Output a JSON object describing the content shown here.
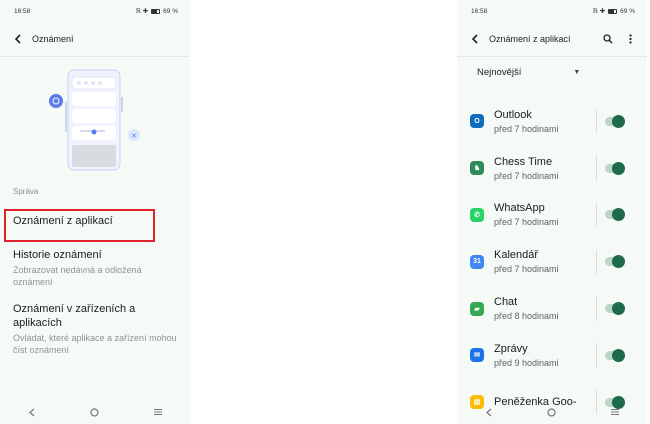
{
  "left": {
    "status": {
      "time": "16:58",
      "icons": "ℝ ✚",
      "battery": "69 %"
    },
    "appbar": {
      "title": "Oznámení"
    },
    "section_header": "Správa",
    "items": [
      {
        "title": "Oznámení z aplikací",
        "subtitle": ""
      },
      {
        "title": "Historie oznámení",
        "subtitle": "Zobrazovat nedávná a odložená oznámení"
      },
      {
        "title": "Oznámení v zařízeních a aplikacích",
        "subtitle": "Ovládat, které aplikace a zařízení mohou číst oznámení"
      }
    ],
    "highlight_color": "#e0242b"
  },
  "right": {
    "status": {
      "time": "16:58",
      "icons": "ℝ ✚",
      "battery": "69 %"
    },
    "appbar": {
      "title": "Oznámení z aplikací"
    },
    "sort": {
      "selected": "Nejnovější"
    },
    "apps": [
      {
        "name": "Outlook",
        "time": "před 7 hodinami",
        "enabled": true,
        "icon": "outlook-icon",
        "color": "#0f6cbd",
        "glyph": "O"
      },
      {
        "name": "Chess Time",
        "time": "před 7 hodinami",
        "enabled": true,
        "icon": "chess-time-icon",
        "color": "#2e8b57",
        "glyph": "♞"
      },
      {
        "name": "WhatsApp",
        "time": "před 7 hodinami",
        "enabled": true,
        "icon": "whatsapp-icon",
        "color": "#25d366",
        "glyph": "✆"
      },
      {
        "name": "Kalendář",
        "time": "před 7 hodinami",
        "enabled": true,
        "icon": "calendar-icon",
        "color": "#4285f4",
        "glyph": "31"
      },
      {
        "name": "Chat",
        "time": "před 8 hodinami",
        "enabled": true,
        "icon": "chat-icon",
        "color": "#34a853",
        "glyph": "▰"
      },
      {
        "name": "Zprávy",
        "time": "před 9 hodinami",
        "enabled": true,
        "icon": "messages-icon",
        "color": "#1a73e8",
        "glyph": "✉"
      },
      {
        "name": "Peněženka Goo-",
        "time": "",
        "enabled": true,
        "icon": "wallet-icon",
        "color": "#fbbc04",
        "glyph": "▤"
      }
    ],
    "accent": "#1e6b4a"
  }
}
